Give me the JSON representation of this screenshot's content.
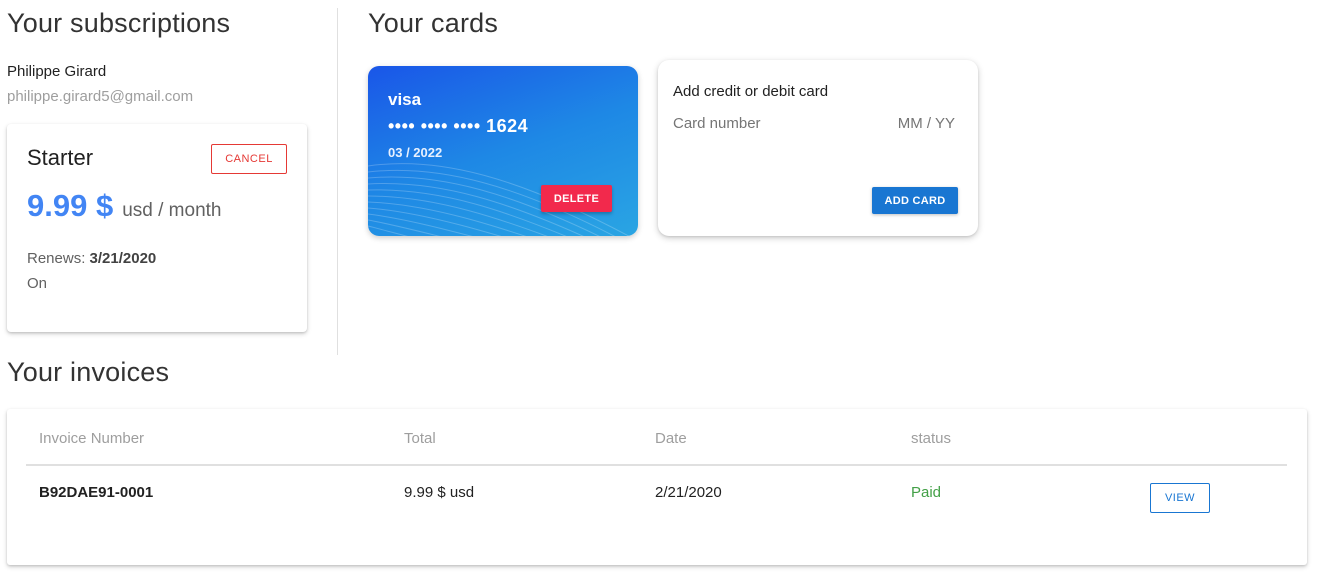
{
  "subscriptions": {
    "title": "Your subscriptions",
    "user_name": "Philippe Girard",
    "user_email": "philippe.girard5@gmail.com",
    "plan": {
      "name": "Starter",
      "cancel_label": "CANCEL",
      "price": "9.99 $",
      "period": "usd / month",
      "renews_label": "Renews:",
      "renews_date": "3/21/2020",
      "status": "On"
    }
  },
  "cards": {
    "title": "Your cards",
    "saved_card": {
      "brand": "visa",
      "number": "•••• •••• •••• 1624",
      "expiry": "03 / 2022",
      "delete_label": "DELETE",
      "gradient_colors": [
        "#1a56e8",
        "#1e88e5",
        "#2aa5e3"
      ]
    },
    "add_card": {
      "title": "Add credit or debit card",
      "card_number_placeholder": "Card number",
      "expiry_placeholder": "MM / YY",
      "add_label": "ADD CARD"
    }
  },
  "invoices": {
    "title": "Your invoices",
    "columns": [
      "Invoice Number",
      "Total",
      "Date",
      "status"
    ],
    "rows": [
      {
        "number": "B92DAE91-0001",
        "total": "9.99 $ usd",
        "date": "2/21/2020",
        "status": "Paid",
        "action": "VIEW"
      }
    ]
  },
  "colors": {
    "accent_blue": "#4285f4",
    "button_blue": "#1976d2",
    "danger_red": "#f2294c",
    "cancel_red": "#e53935",
    "paid_green": "#43a047"
  }
}
